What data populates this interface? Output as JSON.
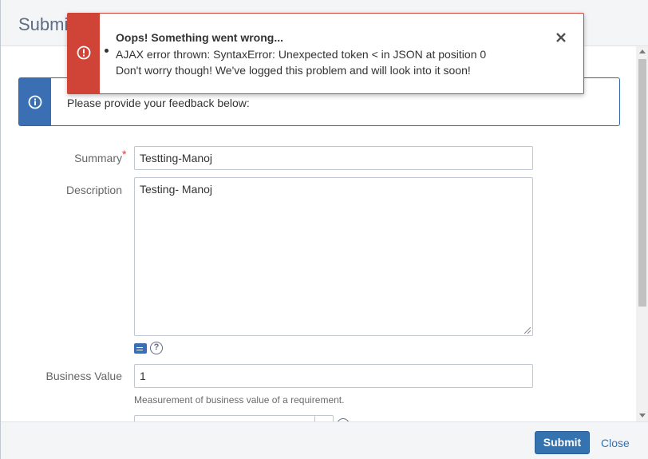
{
  "dialog": {
    "title": "Submit"
  },
  "error_flag": {
    "title": "Oops! Something went wrong...",
    "messages": [
      "AJAX error thrown: SyntaxError: Unexpected token < in JSON at position 0",
      "Don't worry though! We've logged this problem and will look into it soon!"
    ],
    "icon": "error-circle-icon",
    "close_icon": "close-icon",
    "color": "#d04437"
  },
  "info_panel": {
    "text": "Please provide your feedback below:",
    "icon": "info-circle-icon",
    "color": "#3a70b3"
  },
  "form": {
    "summary": {
      "label": "Summary",
      "required_marker": "*",
      "value": "Testting-Manoj"
    },
    "description": {
      "label": "Description",
      "value": "Testing- Manoj"
    },
    "business_value": {
      "label": "Business Value",
      "value": "1",
      "help": "Measurement of business value of a requirement."
    }
  },
  "footer": {
    "submit_label": "Submit",
    "close_label": "Close",
    "accent": "#3572b0"
  }
}
